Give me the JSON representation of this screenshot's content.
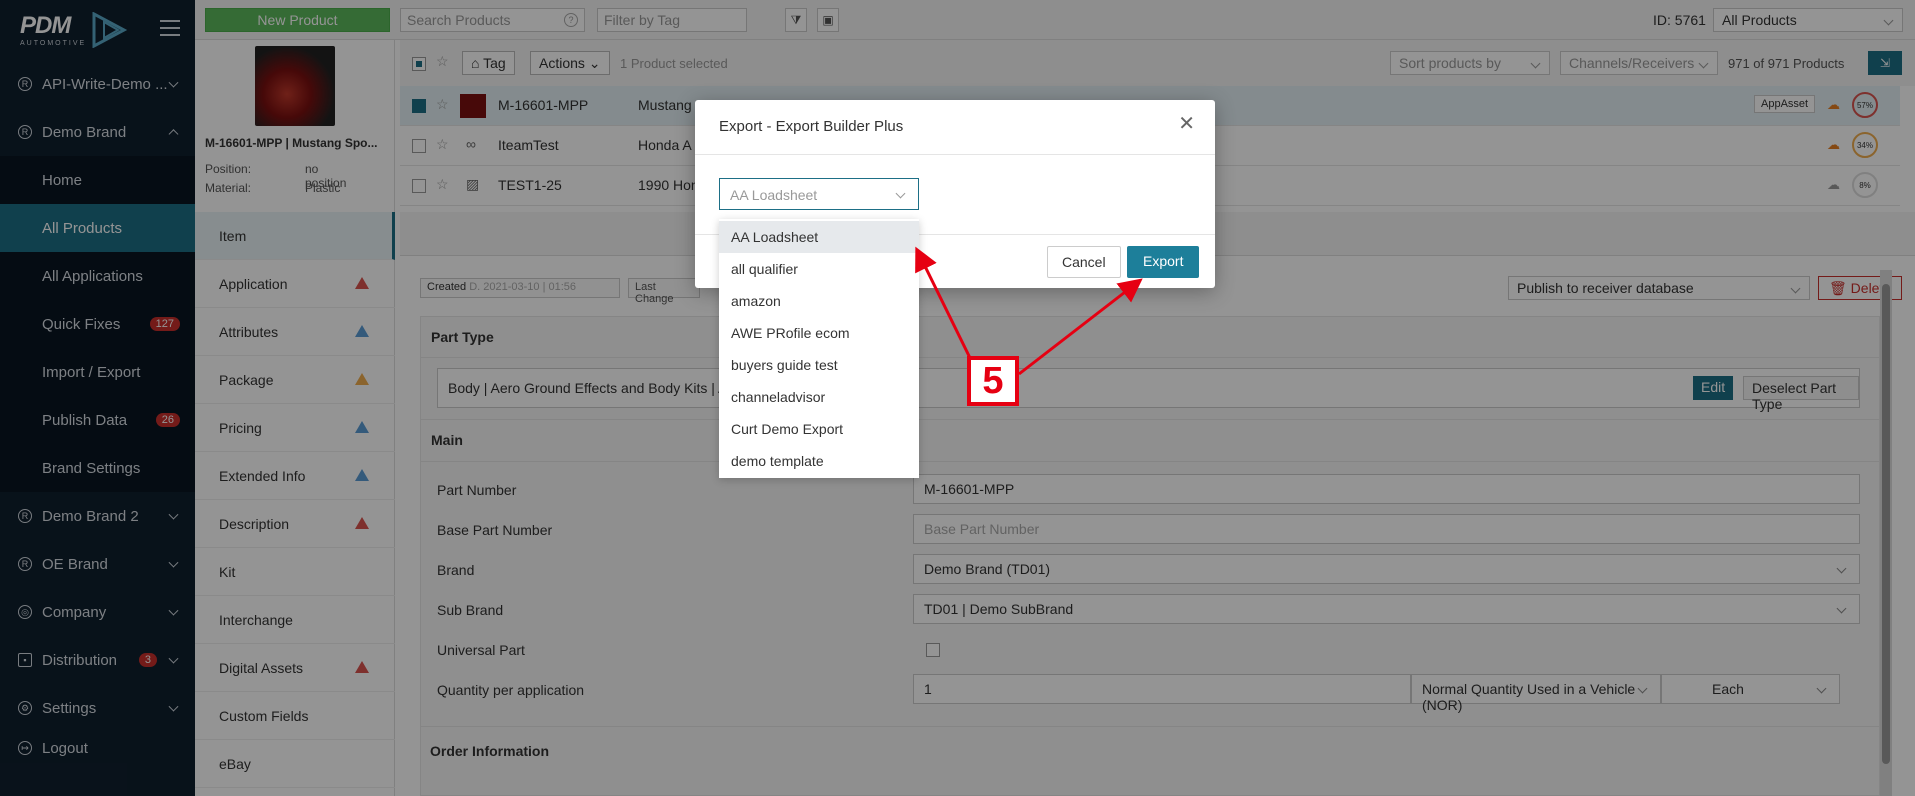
{
  "sidebar": {
    "logo": "PDM",
    "logo_sub": "AUTOMOTIVE",
    "items": [
      {
        "label": "API-Write-Demo ...",
        "icon": "registered-icon"
      },
      {
        "label": "Demo Brand",
        "icon": "registered-icon"
      },
      {
        "label": "Home"
      },
      {
        "label": "All Products"
      },
      {
        "label": "All Applications"
      },
      {
        "label": "Quick Fixes",
        "badge": "127"
      },
      {
        "label": "Import / Export"
      },
      {
        "label": "Publish Data",
        "badge": "26"
      },
      {
        "label": "Brand Settings"
      },
      {
        "label": "Demo Brand 2",
        "icon": "registered-icon"
      },
      {
        "label": "OE Brand",
        "icon": "registered-icon"
      },
      {
        "label": "Company",
        "icon": "globe-icon"
      },
      {
        "label": "Distribution",
        "icon": "distribution-icon",
        "badge": "3"
      },
      {
        "label": "Settings",
        "icon": "gear-icon"
      },
      {
        "label": "Logout",
        "icon": "logout-icon"
      }
    ]
  },
  "topbar": {
    "new_product": "New Product",
    "search_placeholder": "Search Products",
    "tag_placeholder": "Filter by Tag",
    "id_label": "ID: 5761",
    "scope": "All Products"
  },
  "preview": {
    "title": "M-16601-MPP | Mustang Spo...",
    "position_label": "Position:",
    "position_value": "no position",
    "material_label": "Material:",
    "material_value": "Plastic"
  },
  "list": {
    "tag": "Tag",
    "actions": "Actions",
    "selected": "1 Product selected",
    "sort": "Sort products by",
    "channels": "Channels/Receivers",
    "count": "971 of 971 Products",
    "rows": [
      {
        "part": "M-16601-MPP",
        "desc": "Mustang",
        "tag": "AppAsset",
        "pct": "57%"
      },
      {
        "part": "IteamTest",
        "desc": "Honda A",
        "pct": "34%"
      },
      {
        "part": "TEST1-25",
        "desc": "1990 Hon",
        "pct": "8%"
      }
    ]
  },
  "tabs": [
    {
      "label": "Item"
    },
    {
      "label": "Application",
      "warn": "red"
    },
    {
      "label": "Attributes",
      "warn": "blue"
    },
    {
      "label": "Package",
      "warn": "orange"
    },
    {
      "label": "Pricing",
      "warn": "blue"
    },
    {
      "label": "Extended Info",
      "warn": "blue"
    },
    {
      "label": "Description",
      "warn": "red"
    },
    {
      "label": "Kit"
    },
    {
      "label": "Interchange"
    },
    {
      "label": "Digital Assets",
      "warn": "red"
    },
    {
      "label": "Custom Fields"
    },
    {
      "label": "eBay"
    }
  ],
  "main": {
    "created_label": "Created",
    "created_value": "D. 2021-03-10 | 01:56",
    "last_changed": "Last Change",
    "publish": "Publish to receiver database",
    "delete": "Delete",
    "part_type_title": "Part Type",
    "part_type_value": "Body | Aero Ground Effects and Body Kits | A",
    "edit": "Edit",
    "deselect": "Deselect Part Type",
    "main_title": "Main",
    "order_title": "Order Information",
    "fields": {
      "part_number_label": "Part Number",
      "part_number": "M-16601-MPP",
      "base_part_label": "Base Part Number",
      "base_part_placeholder": "Base Part Number",
      "brand_label": "Brand",
      "brand": "Demo Brand (TD01)",
      "sub_brand_label": "Sub Brand",
      "sub_brand": "TD01 | Demo SubBrand",
      "universal_label": "Universal Part",
      "qty_label": "Quantity per application",
      "qty": "1",
      "qty_type": "Normal Quantity Used in a Vehicle (NOR)",
      "qty_unit": "Each"
    }
  },
  "modal": {
    "title": "Export - Export Builder Plus",
    "selected": "AA Loadsheet",
    "cancel": "Cancel",
    "export": "Export",
    "options": [
      "AA Loadsheet",
      "all qualifier",
      "amazon",
      "AWE PRofile ecom",
      "buyers guide test",
      "channeladvisor",
      "Curt Demo Export",
      "demo template"
    ]
  },
  "annotation": {
    "step": "5",
    "color": "#e60012"
  }
}
